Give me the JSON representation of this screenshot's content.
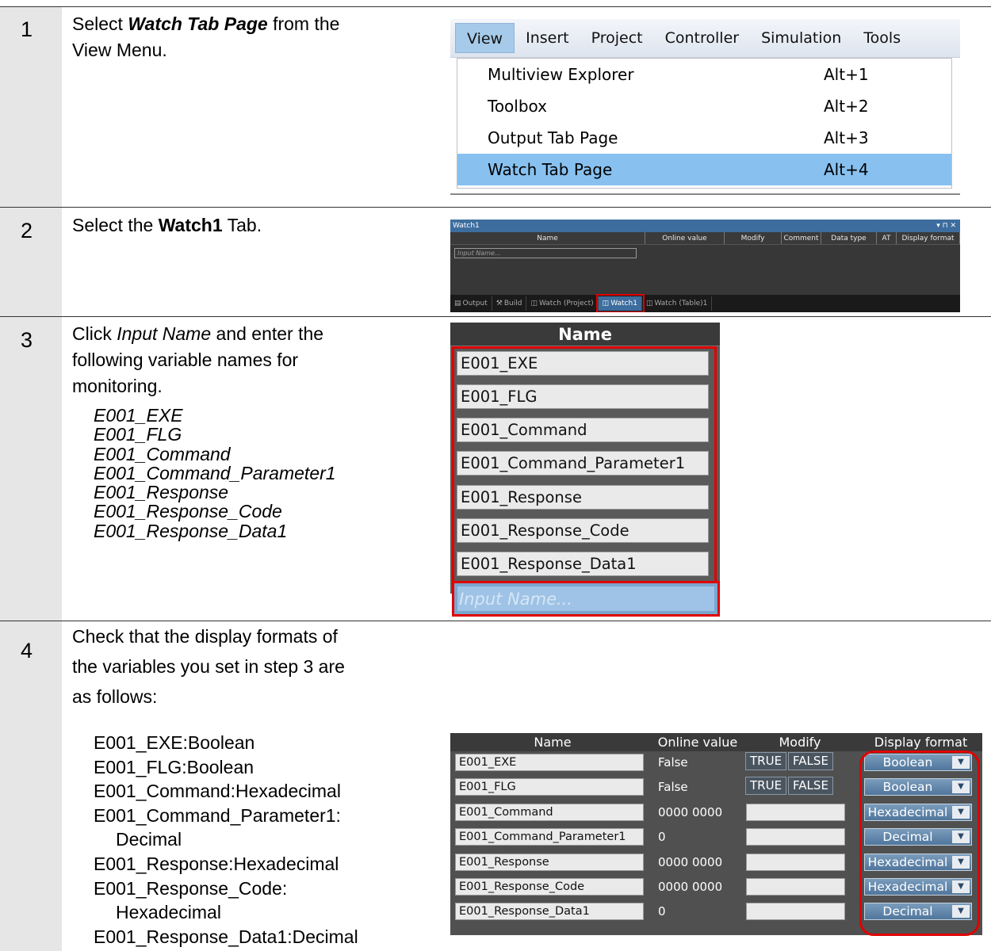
{
  "steps": [
    {
      "num": "1",
      "text_a": "Select ",
      "text_b": "Watch Tab Page",
      "text_c": " from the",
      "text_d": "View Menu."
    },
    {
      "num": "2",
      "text_a": "Select the ",
      "text_b": "Watch1",
      "text_c": " Tab."
    },
    {
      "num": "3",
      "text_a": "Click ",
      "text_b": "Input Name",
      "text_c": " and enter the",
      "text_d": "following variable names for",
      "text_e": "monitoring.",
      "vars": [
        "E001_EXE",
        "E001_FLG",
        "E001_Command",
        "E001_Command_Parameter1",
        "E001_Response",
        "E001_Response_Code",
        "E001_Response_Data1"
      ]
    },
    {
      "num": "4",
      "text_a": "Check that the display formats of",
      "text_b": "the variables you set in step 3 are",
      "text_c": "as follows:",
      "lines": [
        "E001_EXE:Boolean",
        "E001_FLG:Boolean",
        "E001_Command:Hexadecimal",
        "E001_Command_Parameter1:",
        "Decimal",
        "E001_Response:Hexadecimal",
        "E001_Response_Code:",
        "Hexadecimal",
        "E001_Response_Data1:Decimal"
      ]
    }
  ],
  "menu": {
    "bar": [
      "View",
      "Insert",
      "Project",
      "Controller",
      "Simulation",
      "Tools"
    ],
    "items": [
      {
        "label": "Multiview Explorer",
        "shortcut": "Alt+1"
      },
      {
        "label": "Toolbox",
        "shortcut": "Alt+2"
      },
      {
        "label": "Output Tab Page",
        "shortcut": "Alt+3"
      },
      {
        "label": "Watch Tab Page",
        "shortcut": "Alt+4"
      }
    ]
  },
  "watch_pane": {
    "title": "Watch1",
    "controls": "▾ ⊓ ✕",
    "columns": [
      "Name",
      "Online value",
      "Modify",
      "Comment",
      "Data type",
      "AT",
      "Display format"
    ],
    "input_placeholder": "Input Name...",
    "tabs": [
      "Output",
      "Build",
      "Watch (Project)",
      "Watch1",
      "Watch (Table)1"
    ]
  },
  "name_list": {
    "header": "Name",
    "rows": [
      "E001_EXE",
      "E001_FLG",
      "E001_Command",
      "E001_Command_Parameter1",
      "E001_Response",
      "E001_Response_Code",
      "E001_Response_Data1"
    ],
    "input_placeholder": "Input Name..."
  },
  "table": {
    "columns": [
      "Name",
      "Online value",
      "Modify",
      "Display format"
    ],
    "true_label": "TRUE",
    "false_label": "FALSE",
    "arrow": "▼",
    "rows": [
      {
        "name": "E001_EXE",
        "value": "False",
        "format": "Boolean",
        "buttons": true
      },
      {
        "name": "E001_FLG",
        "value": "False",
        "format": "Boolean",
        "buttons": true
      },
      {
        "name": "E001_Command",
        "value": "0000 0000",
        "format": "Hexadecimal",
        "buttons": false
      },
      {
        "name": "E001_Command_Parameter1",
        "value": "0",
        "format": "Decimal",
        "buttons": false
      },
      {
        "name": "E001_Response",
        "value": "0000 0000",
        "format": "Hexadecimal",
        "buttons": false
      },
      {
        "name": "E001_Response_Code",
        "value": "0000 0000",
        "format": "Hexadecimal",
        "buttons": false
      },
      {
        "name": "E001_Response_Data1",
        "value": "0",
        "format": "Decimal",
        "buttons": false
      }
    ]
  }
}
